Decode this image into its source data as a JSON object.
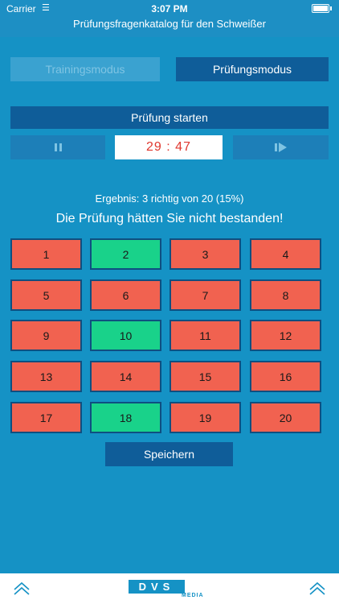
{
  "status_bar": {
    "carrier": "Carrier",
    "time": "3:07 PM"
  },
  "header": {
    "title": "Prüfungsfragenkatalog für den Schweißer"
  },
  "modes": {
    "training": "Trainingsmodus",
    "exam": "Prüfungsmodus",
    "active": "exam"
  },
  "controls": {
    "start": "Prüfung starten",
    "timer": "29 : 47"
  },
  "result": {
    "summary": "Ergebnis: 3 richtig von 20 (15%)",
    "verdict": "Die Prüfung hätten Sie nicht bestanden!"
  },
  "questions": [
    {
      "label": "1",
      "status": "wrong"
    },
    {
      "label": "2",
      "status": "right"
    },
    {
      "label": "3",
      "status": "wrong"
    },
    {
      "label": "4",
      "status": "wrong"
    },
    {
      "label": "5",
      "status": "wrong"
    },
    {
      "label": "6",
      "status": "wrong"
    },
    {
      "label": "7",
      "status": "wrong"
    },
    {
      "label": "8",
      "status": "wrong"
    },
    {
      "label": "9",
      "status": "wrong"
    },
    {
      "label": "10",
      "status": "right"
    },
    {
      "label": "11",
      "status": "wrong"
    },
    {
      "label": "12",
      "status": "wrong"
    },
    {
      "label": "13",
      "status": "wrong"
    },
    {
      "label": "14",
      "status": "wrong"
    },
    {
      "label": "15",
      "status": "wrong"
    },
    {
      "label": "16",
      "status": "wrong"
    },
    {
      "label": "17",
      "status": "wrong"
    },
    {
      "label": "18",
      "status": "right"
    },
    {
      "label": "19",
      "status": "wrong"
    },
    {
      "label": "20",
      "status": "wrong"
    }
  ],
  "actions": {
    "save": "Speichern"
  },
  "footer": {
    "logo_main": "DVS",
    "logo_sub": "MEDIA"
  },
  "colors": {
    "background": "#1592c5",
    "wrong": "#f16250",
    "right": "#19d28a",
    "button": "#0f5d99",
    "timer_text": "#e0372e"
  }
}
